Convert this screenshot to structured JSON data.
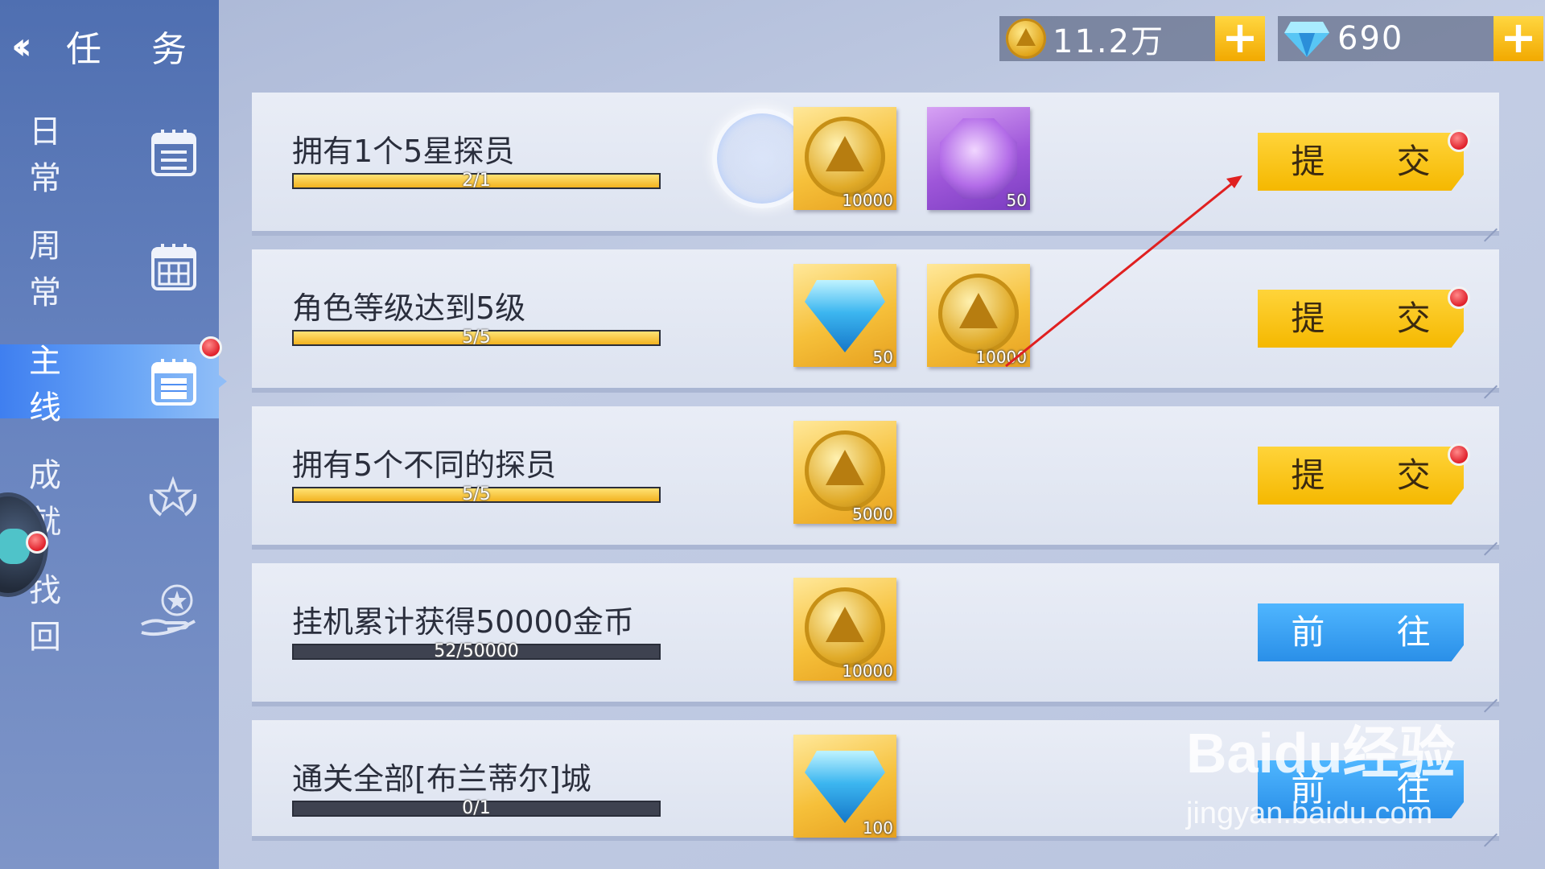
{
  "header": {
    "back_icon": "chevron-left-icon",
    "title": "任 务"
  },
  "sidebar": {
    "items": [
      {
        "label": "日 常",
        "icon": "daily-calendar-icon",
        "active": false
      },
      {
        "label": "周 常",
        "icon": "weekly-calendar-icon",
        "active": false
      },
      {
        "label": "主 线",
        "icon": "main-calendar-icon",
        "active": true,
        "badge": true
      },
      {
        "label": "成 就",
        "icon": "laurel-star-icon",
        "active": false
      },
      {
        "label": "找 回",
        "icon": "hand-star-icon",
        "active": false
      }
    ]
  },
  "currency": {
    "gold": {
      "value": "11.2万",
      "icon": "gold-coin-icon",
      "plus": "+"
    },
    "diamond": {
      "value": "690",
      "icon": "diamond-icon",
      "plus": "+"
    }
  },
  "tasks": [
    {
      "title": "拥有1个5星探员",
      "progress_text": "2/1",
      "progress": 1.0,
      "rewards": [
        {
          "type": "gold-coin",
          "qty": "10000"
        },
        {
          "type": "purple-crystal",
          "qty": "50"
        }
      ],
      "action": "提 交",
      "action_type": "submit",
      "badge": true
    },
    {
      "title": "角色等级达到5级",
      "progress_text": "5/5",
      "progress": 1.0,
      "rewards": [
        {
          "type": "diamond",
          "qty": "50"
        },
        {
          "type": "gold-coin",
          "qty": "10000"
        }
      ],
      "action": "提 交",
      "action_type": "submit",
      "badge": true
    },
    {
      "title": "拥有5个不同的探员",
      "progress_text": "5/5",
      "progress": 1.0,
      "rewards": [
        {
          "type": "gold-coin",
          "qty": "5000"
        }
      ],
      "action": "提 交",
      "action_type": "submit",
      "badge": true
    },
    {
      "title": "挂机累计获得50000金币",
      "progress_text": "52/50000",
      "progress": 0.00104,
      "rewards": [
        {
          "type": "gold-coin",
          "qty": "10000"
        }
      ],
      "action": "前 往",
      "action_type": "goto",
      "badge": false
    },
    {
      "title": "通关全部[布兰蒂尔]城",
      "progress_text": "0/1",
      "progress": 0,
      "rewards": [
        {
          "type": "diamond",
          "qty": "100"
        }
      ],
      "action": "前 往",
      "action_type": "goto",
      "badge": false
    }
  ],
  "watermark": {
    "text": "Baidu经验",
    "url": "jingyan.baidu.com"
  },
  "colors": {
    "accent_yellow": "#f5b800",
    "accent_blue": "#2a8fe8",
    "badge_red": "#e0202a"
  }
}
